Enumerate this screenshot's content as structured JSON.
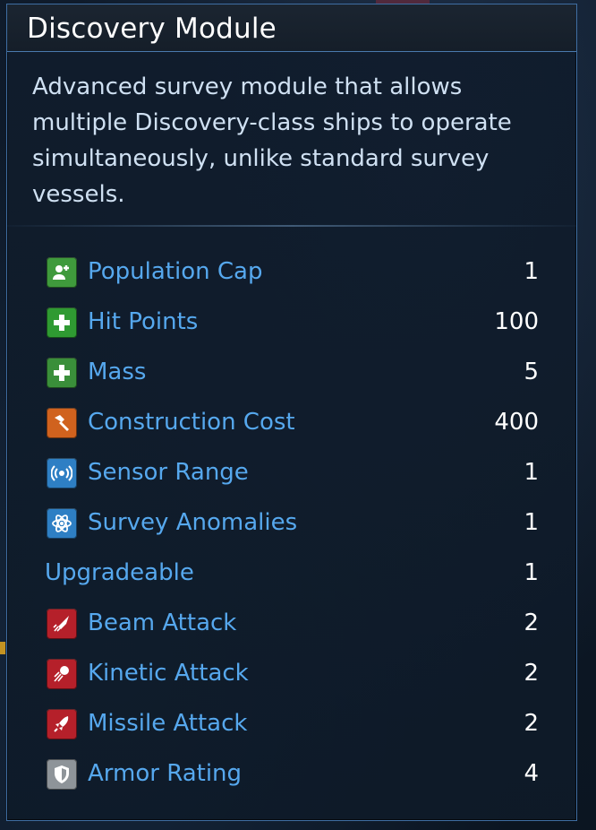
{
  "tooltip": {
    "title": "Discovery Module",
    "description": "Advanced survey module that allows multiple Discovery-class ships to operate simultaneously, unlike standard survey vessels.",
    "stats": [
      {
        "label": "Population Cap",
        "value": "1",
        "icon": "population-plus-icon",
        "icon_color": "#3f9a3c"
      },
      {
        "label": "Hit Points",
        "value": "100",
        "icon": "health-cross-icon",
        "icon_color": "#2f9a32"
      },
      {
        "label": "Mass",
        "value": "5",
        "icon": "health-cross-icon",
        "icon_color": "#3a8f3a"
      },
      {
        "label": "Construction Cost",
        "value": "400",
        "icon": "hammer-icon",
        "icon_color": "#d0621e"
      },
      {
        "label": "Sensor Range",
        "value": "1",
        "icon": "sensor-signal-icon",
        "icon_color": "#2e7fc4"
      },
      {
        "label": "Survey Anomalies",
        "value": "1",
        "icon": "atom-icon",
        "icon_color": "#2e7fc4"
      },
      {
        "label": "Upgradeable",
        "value": "1",
        "icon": "",
        "icon_color": ""
      },
      {
        "label": "Beam Attack",
        "value": "2",
        "icon": "beam-rocket-icon",
        "icon_color": "#b5202a"
      },
      {
        "label": "Kinetic Attack",
        "value": "2",
        "icon": "kinetic-ball-icon",
        "icon_color": "#b5202a"
      },
      {
        "label": "Missile Attack",
        "value": "2",
        "icon": "missile-rocket-icon",
        "icon_color": "#b5202a"
      },
      {
        "label": "Armor Rating",
        "value": "4",
        "icon": "shield-icon",
        "icon_color": "#8e9499"
      }
    ]
  }
}
